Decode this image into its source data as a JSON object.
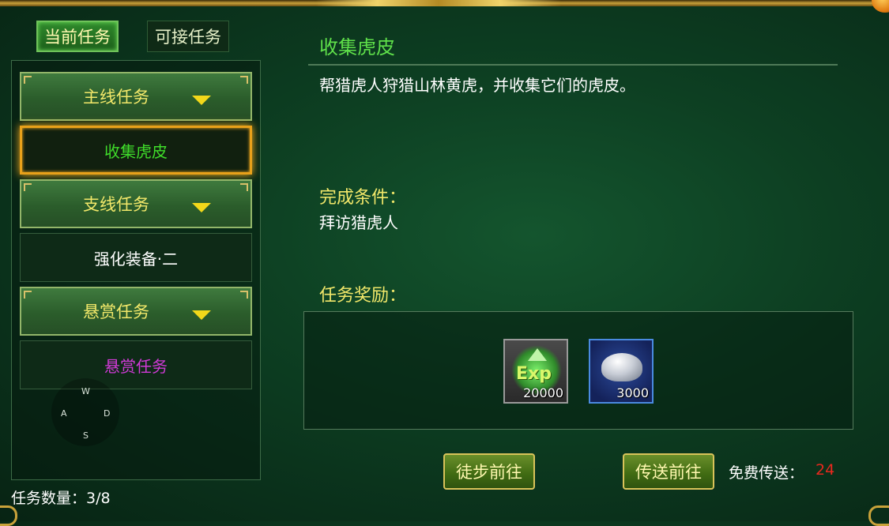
{
  "tabs": {
    "current": "当前任务",
    "available": "可接任务"
  },
  "quest_list": [
    {
      "type": "category",
      "label": "主线任务"
    },
    {
      "type": "quest",
      "label": "收集虎皮",
      "color": "#3fdc2a",
      "selected": true
    },
    {
      "type": "category",
      "label": "支线任务"
    },
    {
      "type": "quest",
      "label": "强化装备·二",
      "color": "#ffffff",
      "selected": false
    },
    {
      "type": "category",
      "label": "悬赏任务"
    },
    {
      "type": "quest",
      "label": "悬赏任务",
      "color": "#d23ad8",
      "selected": false
    }
  ],
  "joystick": {
    "w": "W",
    "a": "A",
    "s": "S",
    "d": "D"
  },
  "quest_count": "任务数量：3/8",
  "detail": {
    "title": "收集虎皮",
    "description": "帮猎虎人狩猎山林黄虎，并收集它们的虎皮。",
    "condition_label": "完成条件：",
    "condition_value": "拜访猎虎人",
    "reward_label": "任务奖励："
  },
  "rewards": [
    {
      "icon": "exp-icon",
      "icon_text": "Exp",
      "amount": "20000"
    },
    {
      "icon": "silver-ingot-icon",
      "amount": "3000"
    }
  ],
  "buttons": {
    "walk": "徒步前往",
    "teleport": "传送前往"
  },
  "free_teleport": {
    "label": "免费传送：",
    "count": "24"
  },
  "colors": {
    "accent_yellow": "#f2e86a",
    "title_green": "#5fe04a",
    "warning_red": "#e8281e"
  }
}
